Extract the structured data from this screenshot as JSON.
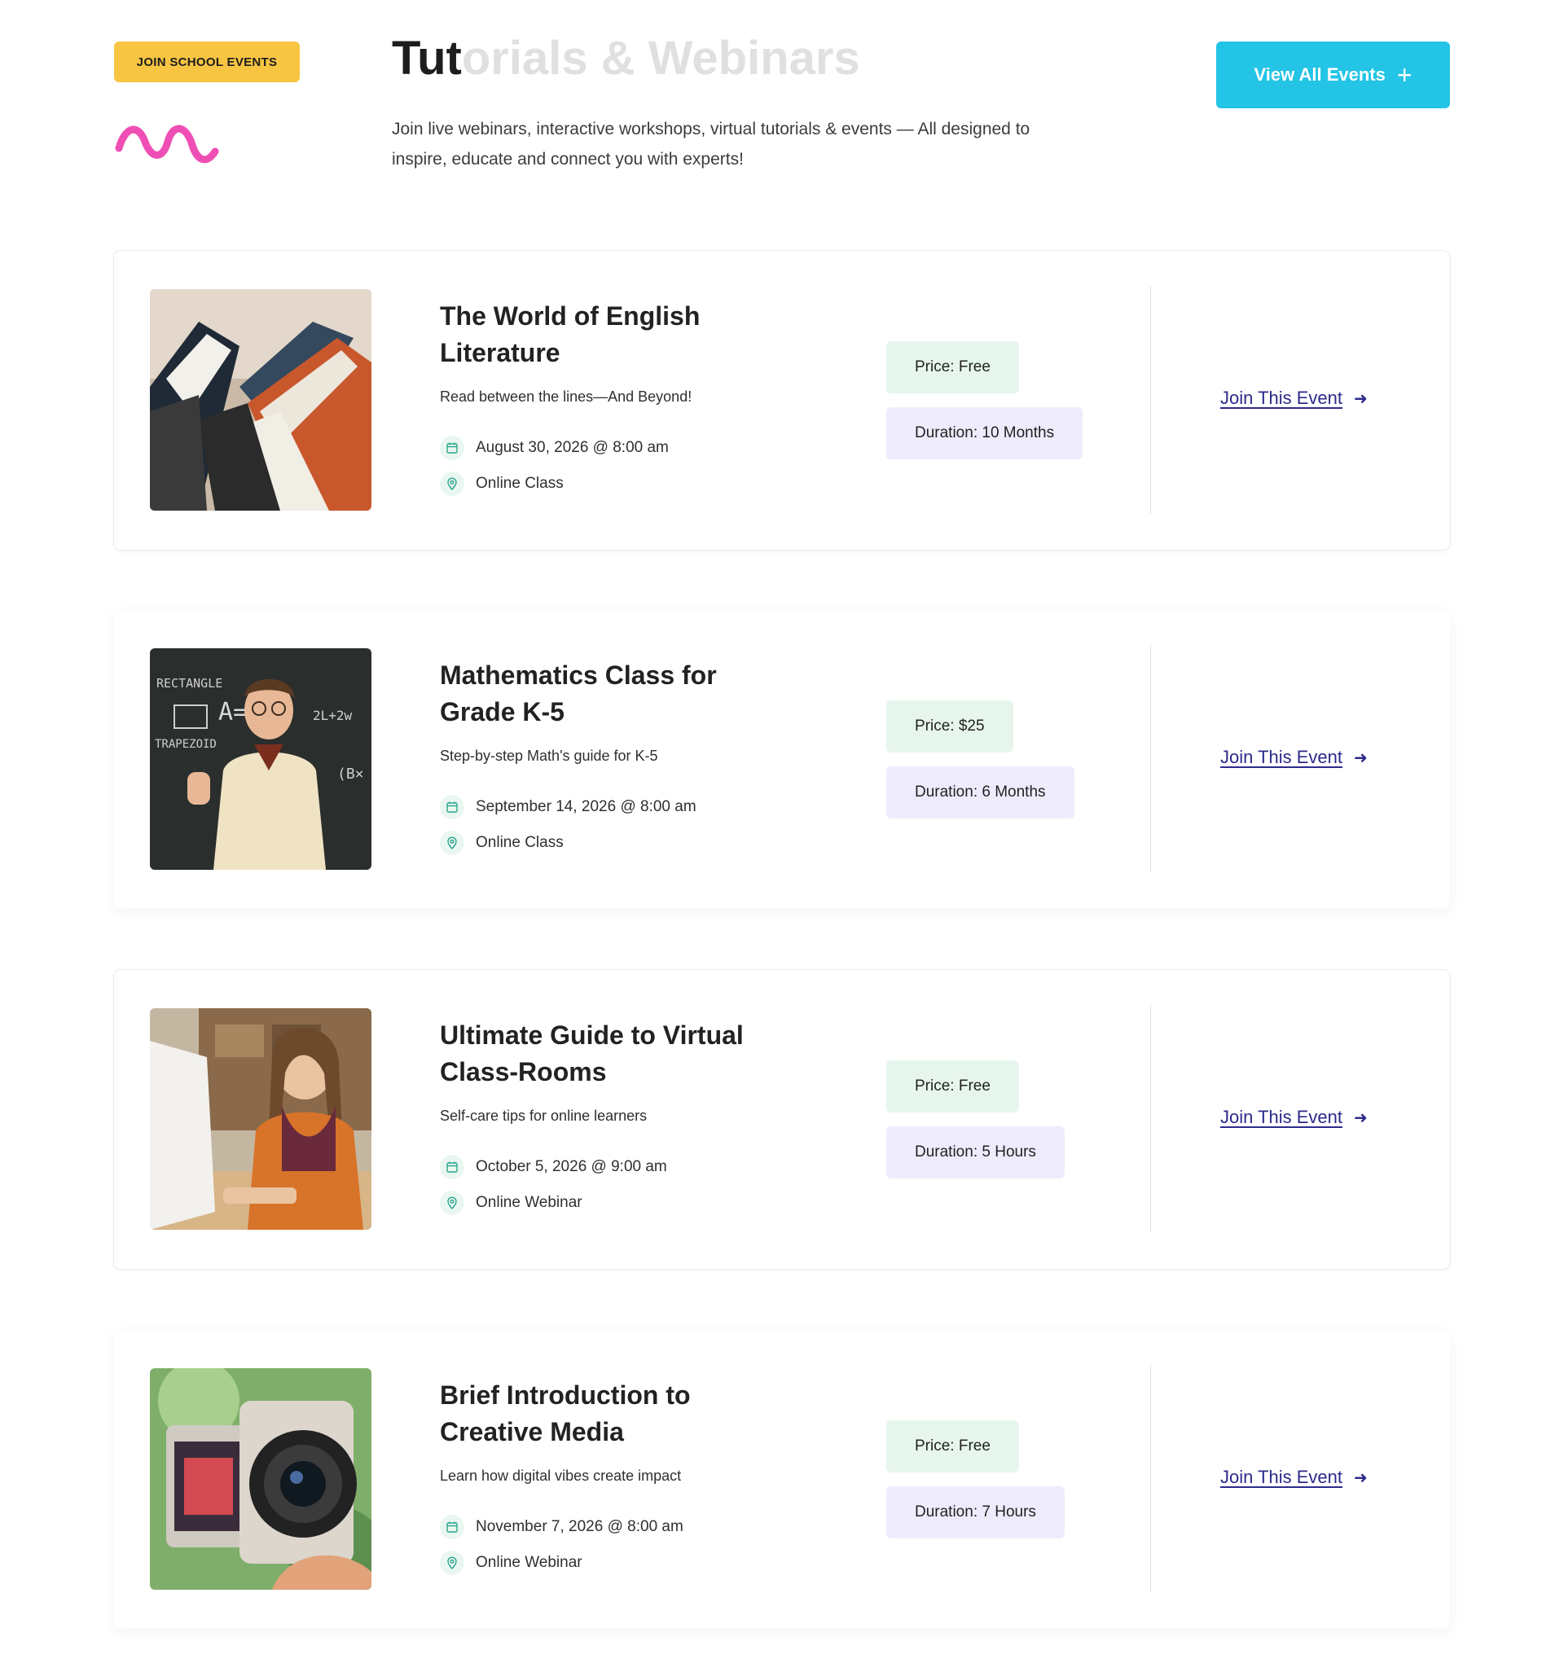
{
  "header": {
    "badge": "JOIN SCHOOL EVENTS",
    "title_dark": "Tut",
    "title_light": "orials & Webinars",
    "subtitle": "Join live webinars, interactive workshops, virtual tutorials & events — All designed to inspire, educate and connect you with experts!",
    "view_all_label": "View All Events"
  },
  "colors": {
    "badge": "#f8c542",
    "squiggle": "#ef4fb5",
    "view_all": "#23c4e5",
    "price_pill": "#e6f6ec",
    "duration_pill": "#eeecfc",
    "link": "#2b2a8a",
    "icon_accent": "#2ba58c"
  },
  "icons": {
    "plus": "plus-icon",
    "calendar": "calendar-icon",
    "location": "location-pin-icon",
    "arrow": "arrow-right-icon"
  },
  "events": [
    {
      "title": "The World of English Literature",
      "description": "Read between the lines—And Beyond!",
      "date": "August 30, 2026 @ 8:00 am",
      "location": "Online Class",
      "price": "Price: Free",
      "duration": "Duration: 10 Months",
      "join_label": "Join This Event"
    },
    {
      "title": "Mathematics Class for Grade K-5",
      "description": "Step-by-step Math's guide for K-5",
      "date": "September 14, 2026 @ 8:00 am",
      "location": "Online Class",
      "price": "Price: $25",
      "duration": "Duration: 6 Months",
      "join_label": "Join This Event"
    },
    {
      "title": "Ultimate Guide to Virtual Class-Rooms",
      "description": "Self-care tips for online learners",
      "date": "October 5, 2026 @ 9:00 am",
      "location": "Online Webinar",
      "price": "Price: Free",
      "duration": "Duration: 5 Hours",
      "join_label": "Join This Event"
    },
    {
      "title": "Brief Introduction to Creative Media",
      "description": "Learn how digital vibes create impact",
      "date": "November 7, 2026 @ 8:00 am",
      "location": "Online Webinar",
      "price": "Price: Free",
      "duration": "Duration: 7 Hours",
      "join_label": "Join This Event"
    }
  ]
}
